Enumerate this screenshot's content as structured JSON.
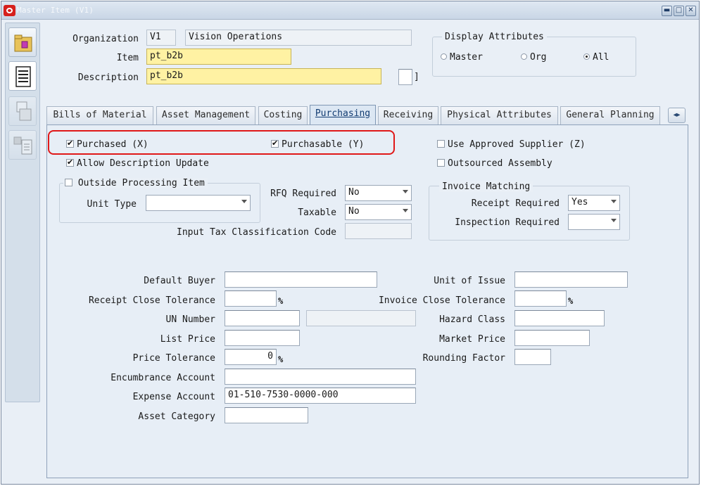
{
  "window": {
    "title": "Master Item (V1)",
    "minimize": "▬",
    "maximize": "□",
    "close": "✕"
  },
  "toolbar": {
    "items": [
      "navigator-icon",
      "document-icon",
      "calendar-icon",
      "list-icon"
    ]
  },
  "header": {
    "organization_label": "Organization",
    "organization_code": "V1",
    "organization_name": "Vision Operations",
    "item_label": "Item",
    "item_value": "pt_b2b",
    "description_label": "Description",
    "description_value": "pt_b2b",
    "desc_bracket": "]"
  },
  "display_attributes": {
    "title": "Display Attributes",
    "options": [
      "Master",
      "Org",
      "All"
    ],
    "selected": "All"
  },
  "tabs": [
    "Bills of Material",
    "Asset Management",
    "Costing",
    "Purchasing",
    "Receiving",
    "Physical Attributes",
    "General Planning"
  ],
  "active_tab": "Purchasing",
  "tab_scroll": "◂▸",
  "purchasing": {
    "purchased": {
      "label": "Purchased (X)",
      "checked": true
    },
    "purchasable": {
      "label": "Purchasable (Y)",
      "checked": true
    },
    "use_approved_supplier": {
      "label": "Use Approved Supplier (Z)",
      "checked": false
    },
    "allow_description_update": {
      "label": "Allow Description Update",
      "checked": true
    },
    "outsourced_assembly": {
      "label": "Outsourced Assembly",
      "checked": false
    },
    "outside_processing": {
      "label": "Outside Processing Item",
      "checked": false,
      "unit_type_label": "Unit Type",
      "unit_type_value": ""
    },
    "rfq_required_label": "RFQ Required",
    "rfq_required_value": "No",
    "taxable_label": "Taxable",
    "taxable_value": "No",
    "input_tax_label": "Input Tax Classification Code",
    "input_tax_value": "",
    "invoice_matching": {
      "title": "Invoice Matching",
      "receipt_required_label": "Receipt Required",
      "receipt_required_value": "Yes",
      "inspection_required_label": "Inspection Required",
      "inspection_required_value": ""
    },
    "default_buyer_label": "Default Buyer",
    "default_buyer_value": "",
    "receipt_close_tolerance_label": "Receipt Close Tolerance",
    "receipt_close_tolerance_value": "",
    "un_number_label": "UN Number",
    "un_number_value": "",
    "un_desc_value": "",
    "list_price_label": "List Price",
    "list_price_value": "",
    "price_tolerance_label": "Price Tolerance",
    "price_tolerance_value": "0",
    "encumbrance_account_label": "Encumbrance Account",
    "encumbrance_account_value": "",
    "expense_account_label": "Expense Account",
    "expense_account_value": "01-510-7530-0000-000",
    "asset_category_label": "Asset Category",
    "asset_category_value": "",
    "unit_of_issue_label": "Unit of Issue",
    "unit_of_issue_value": "",
    "invoice_close_tolerance_label": "Invoice Close Tolerance",
    "invoice_close_tolerance_value": "",
    "hazard_class_label": "Hazard Class",
    "hazard_class_value": "",
    "market_price_label": "Market Price",
    "market_price_value": "",
    "rounding_factor_label": "Rounding Factor",
    "rounding_factor_value": "",
    "percent": "%"
  },
  "colors": {
    "highlight": "#e01818",
    "required_field": "#fff2a3",
    "panel": "#e7eef6"
  }
}
